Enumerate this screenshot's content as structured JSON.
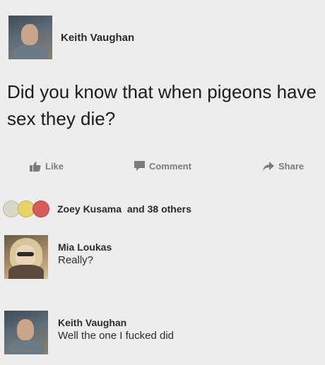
{
  "post": {
    "author": "Keith Vaughan",
    "text": "Did you know that when pigeons have sex they die?"
  },
  "actions": {
    "like_label": "Like",
    "comment_label": "Comment",
    "share_label": "Share"
  },
  "reactions": {
    "names": "Zoey Kusama",
    "others": "and 38 others",
    "icons": [
      "like-icon",
      "haha-icon",
      "love-icon"
    ]
  },
  "comments": [
    {
      "author": "Mia Loukas",
      "text": "Really?"
    },
    {
      "author": "Keith Vaughan",
      "text": "Well the one I fucked did"
    }
  ]
}
